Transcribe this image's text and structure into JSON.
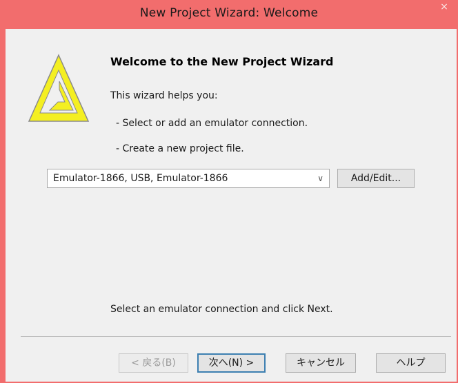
{
  "window": {
    "title": "New Project Wizard: Welcome",
    "close_glyph": "×"
  },
  "welcome": {
    "heading": "Welcome to the New Project Wizard",
    "intro": "This wizard helps you:",
    "bullets": [
      "-  Select or add an emulator connection.",
      "-  Create a new project file."
    ]
  },
  "connection": {
    "selected": "Emulator-1866, USB, Emulator-1866",
    "arrow_glyph": "∨",
    "add_edit_label": "Add/Edit..."
  },
  "footer": {
    "hint": "Select an emulator connection and click Next."
  },
  "buttons": {
    "back": "< 戻る(B)",
    "next": "次へ(N) >",
    "cancel": "キャンセル",
    "help": "ヘルプ"
  },
  "colors": {
    "titlebar": "#f26d6d",
    "logo_fill": "#f4ef21",
    "logo_outline": "#8a8a8a"
  }
}
